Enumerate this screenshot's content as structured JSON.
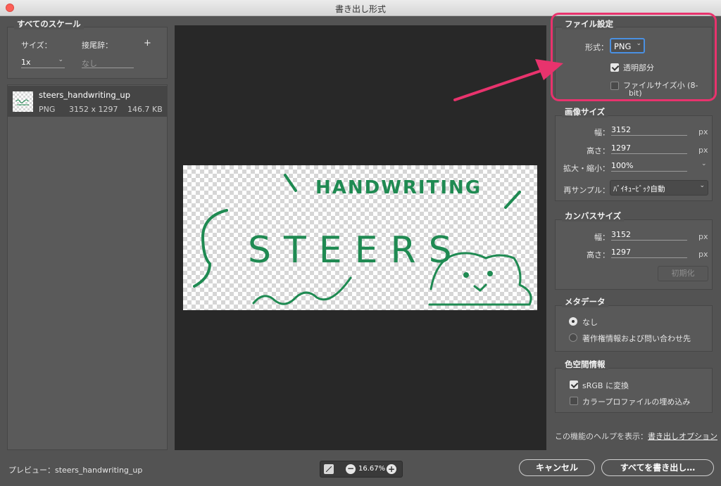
{
  "window": {
    "title": "書き出し形式"
  },
  "scales": {
    "group_label": "すべてのスケール",
    "size_label": "サイズ：",
    "suffix_label": "接尾辞：",
    "add_symbol": "+",
    "size_value": "1x",
    "suffix_placeholder": "なし"
  },
  "asset": {
    "name": "steers_handwriting_up",
    "format": "PNG",
    "dimensions": "3152 x 1297",
    "filesize": "146.7 KB"
  },
  "preview": {
    "label": "プレビュー：steers_handwriting_up",
    "zoom": "16.67%",
    "artwork": {
      "handwriting_text": "HANDWRITING",
      "main_text": "STEERS"
    }
  },
  "file_settings": {
    "group_label": "ファイル設定",
    "format_label": "形式：",
    "format_value": "PNG",
    "transparency_label": "透明部分",
    "transparency_checked": true,
    "smaller_file_label_line1": "ファイルサイズ小 (8-",
    "smaller_file_label_line2": "bit)",
    "smaller_file_checked": false
  },
  "image_size": {
    "group_label": "画像サイズ",
    "width_label": "幅：",
    "width_value": "3152",
    "height_label": "高さ：",
    "height_value": "1297",
    "unit": "px",
    "scale_label": "拡大・縮小：",
    "scale_value": "100%",
    "resample_label": "再サンプル：",
    "resample_value": "ﾊﾞｲｷｭｰﾋﾞｯｸ自動"
  },
  "canvas_size": {
    "group_label": "カンバスサイズ",
    "width_label": "幅：",
    "width_value": "3152",
    "height_label": "高さ：",
    "height_value": "1297",
    "unit": "px",
    "reset_label": "初期化"
  },
  "metadata": {
    "group_label": "メタデータ",
    "option_none": "なし",
    "option_copyright": "著作権情報および問い合わせ先",
    "selected": "none"
  },
  "color_space": {
    "group_label": "色空間情報",
    "srgb_label": "sRGB に変換",
    "srgb_checked": true,
    "embed_label": "カラープロファイルの埋め込み",
    "embed_checked": false
  },
  "help": {
    "prefix": "この機能のヘルプを表示：",
    "link": "書き出しオプション"
  },
  "footer": {
    "cancel_label": "キャンセル",
    "export_all_label": "すべてを書き出し…"
  },
  "colors": {
    "annotation": "#e8336d",
    "ink": "#1f8a52",
    "focus": "#4a90e2"
  }
}
